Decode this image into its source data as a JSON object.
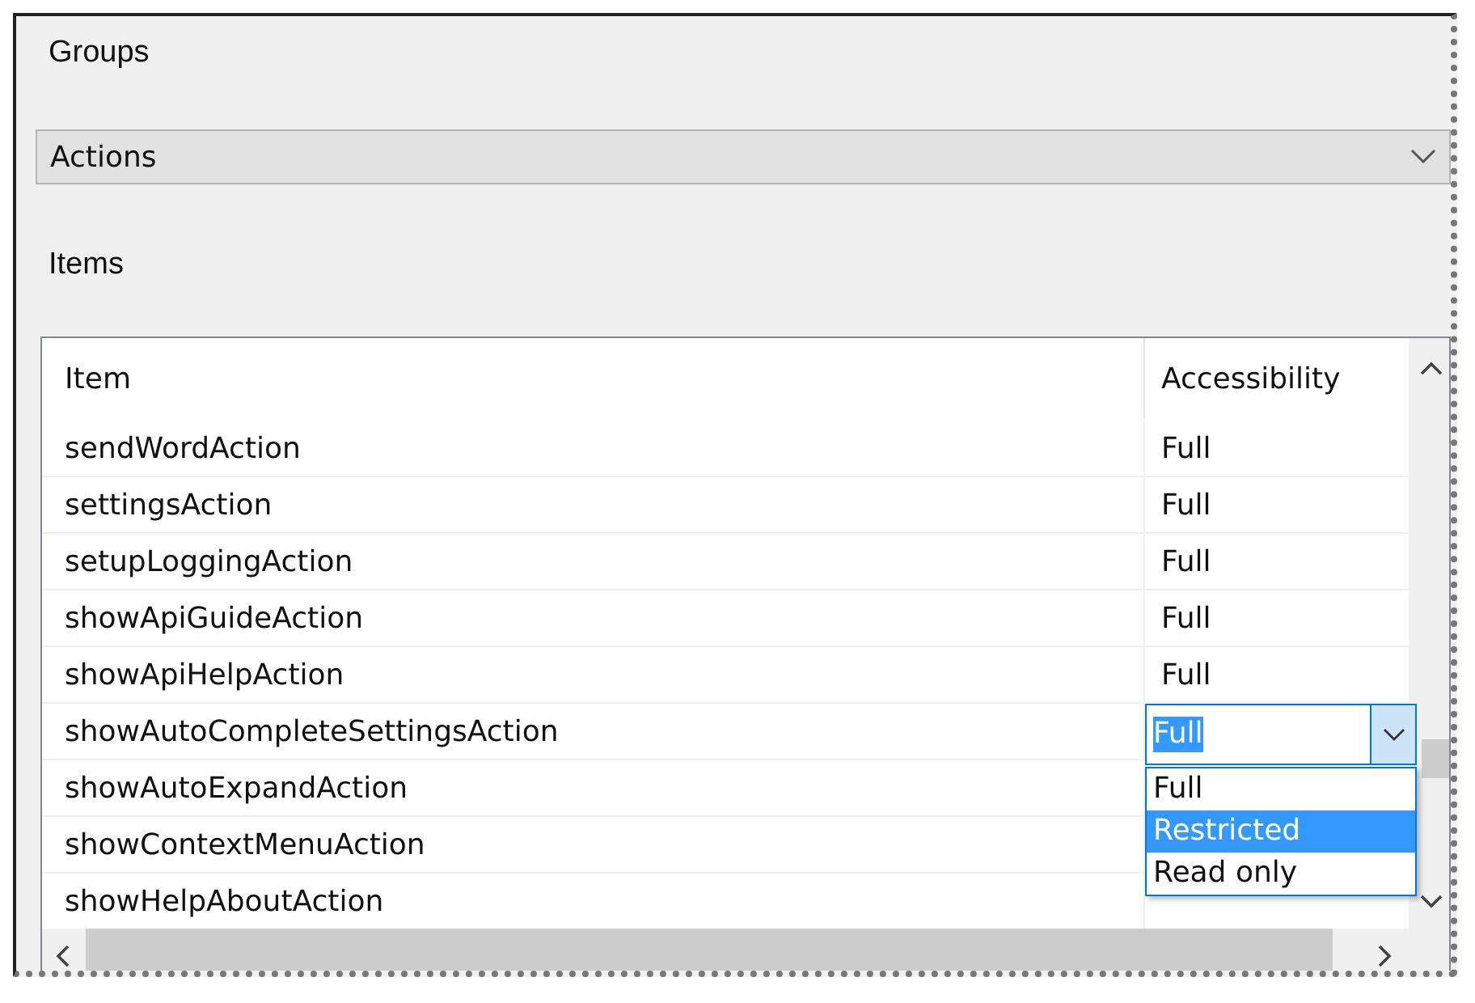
{
  "groups": {
    "label": "Groups",
    "value": "Actions"
  },
  "items": {
    "label": "Items",
    "columns": [
      "Item",
      "Accessibility"
    ],
    "rows": [
      {
        "item": "sendWordAction",
        "accessibility": "Full",
        "editing": false
      },
      {
        "item": "settingsAction",
        "accessibility": "Full",
        "editing": false
      },
      {
        "item": "setupLoggingAction",
        "accessibility": "Full",
        "editing": false
      },
      {
        "item": "showApiGuideAction",
        "accessibility": "Full",
        "editing": false
      },
      {
        "item": "showApiHelpAction",
        "accessibility": "Full",
        "editing": false
      },
      {
        "item": "showAutoCompleteSettingsAction",
        "accessibility": "Full",
        "editing": true
      },
      {
        "item": "showAutoExpandAction",
        "editing": false
      },
      {
        "item": "showContextMenuAction",
        "editing": false
      },
      {
        "item": "showHelpAboutAction",
        "editing": false
      }
    ],
    "dropdown": [
      {
        "label": "Full",
        "selected": false
      },
      {
        "label": "Restricted",
        "selected": true
      },
      {
        "label": "Read only",
        "selected": false
      }
    ]
  }
}
